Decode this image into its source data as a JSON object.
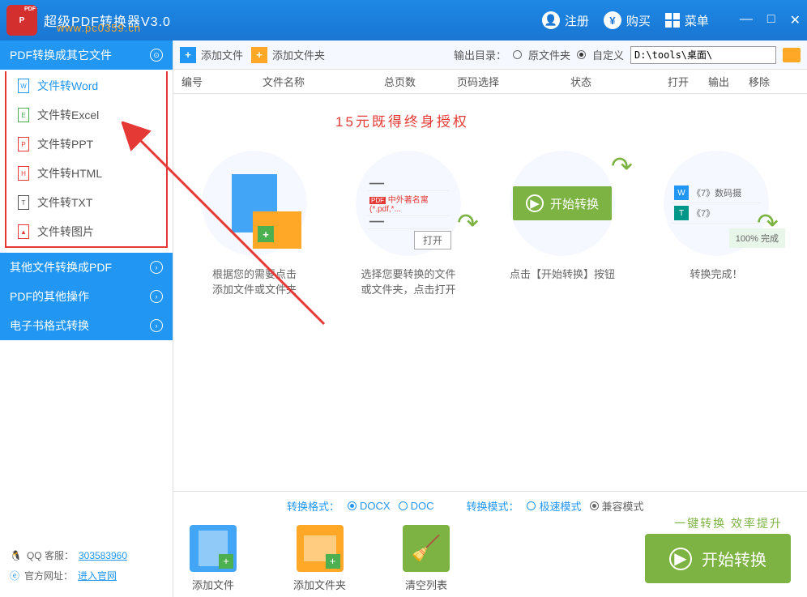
{
  "app": {
    "title": "超级PDF转换器V3.0",
    "watermark": "www.pc0359.cn"
  },
  "header": {
    "register": "注册",
    "buy": "购买",
    "menu": "菜单"
  },
  "sidebar": {
    "cat1": "PDF转换成其它文件",
    "items": [
      "文件转Word",
      "文件转Excel",
      "文件转PPT",
      "文件转HTML",
      "文件转TXT",
      "文件转图片"
    ],
    "cat2": "其他文件转换成PDF",
    "cat3": "PDF的其他操作",
    "cat4": "电子书格式转换",
    "qq_label": "QQ 客服：",
    "qq": "303583960",
    "site_label": "官方网址：",
    "site": "进入官网"
  },
  "toolbar": {
    "add_file": "添加文件",
    "add_folder": "添加文件夹",
    "output_label": "输出目录：",
    "opt_orig": "原文件夹",
    "opt_custom": "自定义",
    "path": "D:\\tools\\桌面\\"
  },
  "columns": [
    "编号",
    "文件名称",
    "总页数",
    "页码选择",
    "状态",
    "打开",
    "输出",
    "移除"
  ],
  "promo": "15元既得终身授权",
  "steps": {
    "s1": "根据您的需要点击\n添加文件或文件夹",
    "s2a": "中外著名寓(*.pdf,*...",
    "s2_open": "打开",
    "s2": "选择您要转换的文件\n或文件夹，点击打开",
    "s3_btn": "开始转换",
    "s3": "点击【开始转换】按钮",
    "s4_f1": "《7》数码摄",
    "s4_f2": "《7》",
    "s4_done": "100%  完成",
    "s4": "转换完成！"
  },
  "options": {
    "format_label": "转换格式：",
    "docx": "DOCX",
    "doc": "DOC",
    "mode_label": "转换模式：",
    "fast": "极速模式",
    "compat": "兼容模式"
  },
  "actions": {
    "add_file": "添加文件",
    "add_folder": "添加文件夹",
    "clear": "清空列表",
    "tagline": "一键转换  效率提升",
    "start": "开始转换"
  }
}
